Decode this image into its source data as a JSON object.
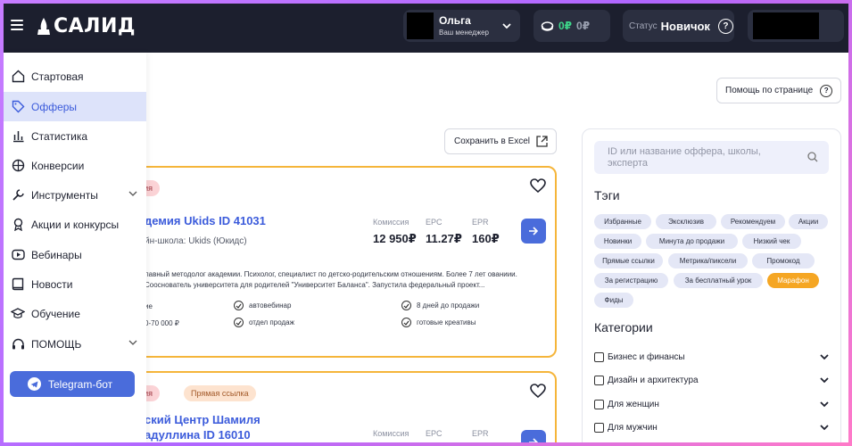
{
  "header": {
    "logo_text": "САЛИД",
    "user_name": "Ольга",
    "user_role": "Ваш менеджер",
    "balance_primary": "0₽",
    "balance_secondary": "0₽",
    "status_label": "Статус",
    "status_value": "Новичок",
    "help_symbol": "?"
  },
  "sidebar": {
    "items": [
      {
        "label": "Стартовая",
        "icon": "home-icon"
      },
      {
        "label": "Офферы",
        "icon": "tag-icon"
      },
      {
        "label": "Статистика",
        "icon": "bar-chart-icon"
      },
      {
        "label": "Конверсии",
        "icon": "crosshair-icon"
      },
      {
        "label": "Инструменты",
        "icon": "wrench-icon"
      },
      {
        "label": "Акции и конкурсы",
        "icon": "award-icon"
      },
      {
        "label": "Вебинары",
        "icon": "video-icon"
      },
      {
        "label": "Новости",
        "icon": "book-icon"
      },
      {
        "label": "Обучение",
        "icon": "graduation-cap-icon"
      },
      {
        "label": "ПОМОЩЬ",
        "icon": "headphones-icon"
      }
    ],
    "telegram_label": "Telegram-бот"
  },
  "main": {
    "page_help_label": "Помощь по странице",
    "excel_label": "Сохранить в Excel"
  },
  "offers": [
    {
      "badges": [
        "Акция"
      ],
      "title": "демия Ukids ID 41031",
      "subtitle": "йн-школа: Ukids (Юкидс)",
      "metrics": {
        "commission_label": "Комиссия",
        "commission_value": "12 950₽",
        "epc_label": "EPC",
        "epc_value": "11.27₽",
        "epr_label": "EPR",
        "epr_value": "160₽"
      },
      "description": "лавный методолог академии. Психолог, специалист по детско-родительским отношениям. Более 7 лет ованиии. Сооснователь университета для родителей \"Университет Баланса\". Запустила федеральный проект...",
      "features_col1": [
        "ие",
        "0-70 000 ₽"
      ],
      "features_col2": [
        "автовебинар",
        "отдел продаж"
      ],
      "features_col3": [
        "8 дней до продажи",
        "готовые креативы"
      ]
    },
    {
      "badges": [
        "Акция",
        "Прямая ссылка"
      ],
      "title_line1": "ский Центр Шамиля",
      "title_line2": "адуллина ID 16010",
      "metrics": {
        "commission_label": "Комиссия",
        "epc_label": "EPC",
        "epr_label": "EPR"
      }
    }
  ],
  "filter": {
    "search_placeholder": "ID или название оффера, школы, эксперта",
    "tags_title": "Тэги",
    "tags": [
      "Избранные",
      "Эксклюзив",
      "Рекомендуем",
      "Акции",
      "Новинки",
      "Минута до продажи",
      "Низкий чек",
      "Прямые ссылки",
      "Метрика/пиксели",
      "Промокод",
      "За регистрацию",
      "За бесплатный урок",
      "Марафон",
      "Фиды"
    ],
    "highlighted_tag": "Марафон",
    "categories_title": "Категории",
    "categories": [
      "Бизнес и финансы",
      "Дизайн и архитектура",
      "Для женщин",
      "Для мужчин"
    ]
  },
  "colors": {
    "header_bg": "#1c1f2e",
    "accent_blue": "#4a6cdb",
    "active_nav_bg": "#dde3fa",
    "card_border": "#f5b53a",
    "balance_green": "#3ed68a",
    "tag_highlight": "#f5a623"
  }
}
